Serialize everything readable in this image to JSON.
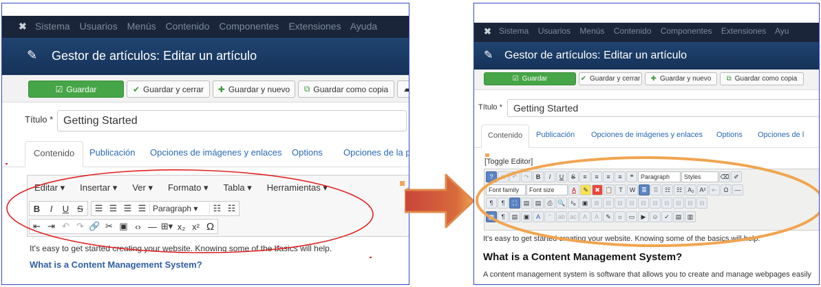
{
  "brand_icon": "joomla-logo-icon",
  "left": {
    "menu": [
      "Sistema",
      "Usuarios",
      "Menús",
      "Contenido",
      "Componentes",
      "Extensiones",
      "Ayuda"
    ],
    "page_title": "Gestor de artículos: Editar un artículo",
    "toolbar": {
      "save": "Guardar",
      "save_close": "Guardar y cerrar",
      "save_new": "Guardar y nuevo",
      "save_copy": "Guardar como copia"
    },
    "title_label": "Título *",
    "title_value": "Getting Started",
    "tabs": [
      "Contenido",
      "Publicación",
      "Opciones de imágenes y enlaces",
      "Options",
      "Opciones de la pa"
    ],
    "editor_menu": [
      "Editar ▾",
      "Insertar ▾",
      "Ver ▾",
      "Formato ▾",
      "Tabla ▾",
      "Herramientas ▾"
    ],
    "format_select": "Paragraph",
    "body_text": "It's easy to get started creating your website. Knowing some of the basics will help.",
    "body_heading": "What is a Content Management System?"
  },
  "right": {
    "menu": [
      "Sistema",
      "Usuarios",
      "Menús",
      "Contenido",
      "Componentes",
      "Extensiones",
      "Ayu"
    ],
    "page_title": "Gestor de artículos: Editar un artículo",
    "toolbar": {
      "save": "Guardar",
      "save_close": "Guardar y cerrar",
      "save_new": "Guardar y nuevo",
      "save_copy": "Guardar como copia"
    },
    "title_label": "Título *",
    "title_value": "Getting Started",
    "tabs": [
      "Contenido",
      "Publicación",
      "Opciones de imágenes y enlaces",
      "Options",
      "Opciones de l"
    ],
    "toggle_editor": "[Toggle Editor]",
    "format_select": "Paragraph",
    "styles_select": "Styles",
    "font_family": "Font family",
    "font_size": "Font size",
    "body_text": "It's easy to get started creating your website. Knowing some of the basics will help.",
    "body_heading": "What is a Content Management System?",
    "body_text2": "A content management system is software that allows you to create and manage webpages easily"
  },
  "colors": {
    "accent_green": "#46a546",
    "header_blue": "#1b3c66",
    "annotation_red": "#e02020",
    "annotation_orange": "#f0a550",
    "frame_blue": "#3344cc"
  }
}
